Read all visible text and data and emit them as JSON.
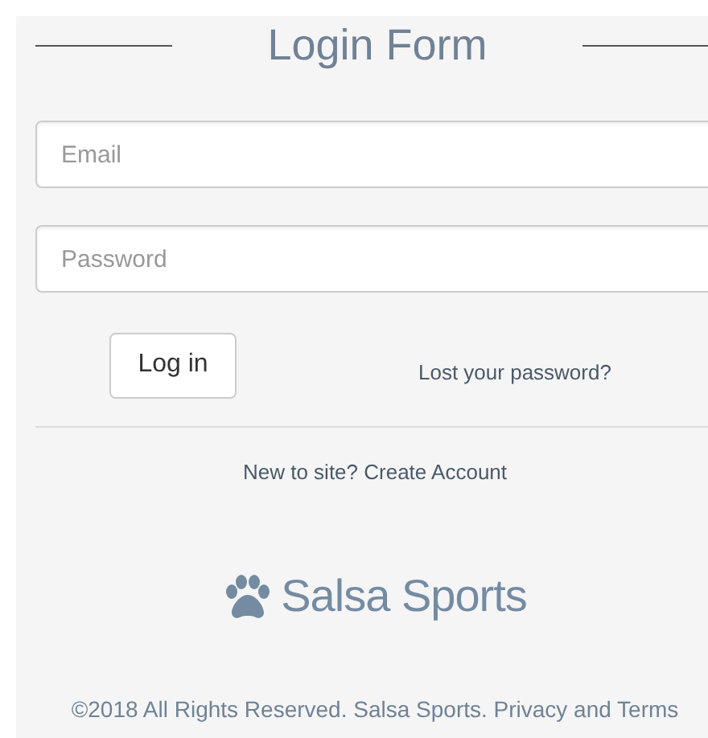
{
  "title": "Login Form",
  "fields": [
    {
      "placeholder": "Email"
    },
    {
      "placeholder": "Password"
    }
  ],
  "login_button": "Log in",
  "lost_password_link": "Lost your password?",
  "signup_text": "New to site? Create Account",
  "brand": "Salsa Sports",
  "footer": "©2018 All Rights Reserved. Salsa Sports. Privacy and Terms"
}
